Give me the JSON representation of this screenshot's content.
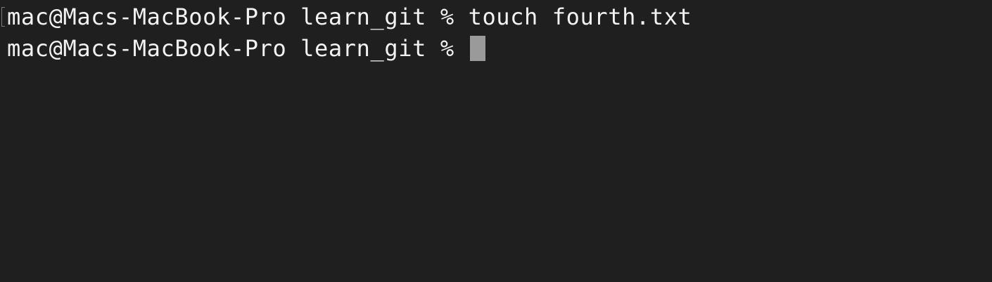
{
  "terminal": {
    "background": "#1f1f1f",
    "text_color": "#f2f2f2",
    "cursor_color": "#9a9a9a",
    "lines": [
      {
        "prompt": "mac@Macs-MacBook-Pro learn_git % ",
        "command": "touch fourth.txt"
      },
      {
        "prompt": "mac@Macs-MacBook-Pro learn_git % ",
        "command": ""
      }
    ]
  }
}
